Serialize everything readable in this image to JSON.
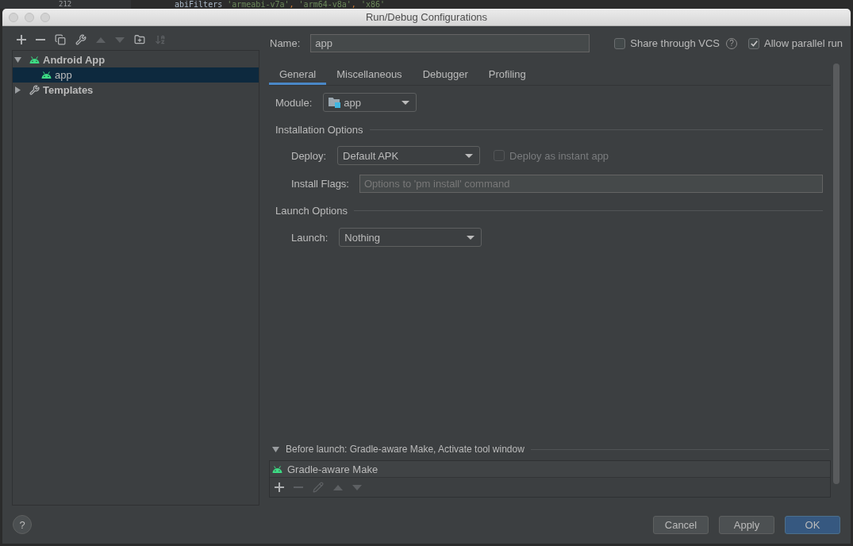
{
  "background_editor": {
    "line_number": "212",
    "tokens": [
      {
        "kind": "identifier",
        "text": "abiFilters"
      },
      {
        "kind": "string",
        "text": "'armeabi-v7a'"
      },
      {
        "kind": "punct",
        "text": ","
      },
      {
        "kind": "string",
        "text": "'arm64-v8a'"
      },
      {
        "kind": "punct",
        "text": ","
      },
      {
        "kind": "string",
        "text": "'x86'"
      }
    ]
  },
  "window": {
    "title": "Run/Debug Configurations"
  },
  "toolbar": [
    {
      "kind": "add",
      "disabled": false
    },
    {
      "kind": "remove",
      "disabled": false
    },
    {
      "kind": "copy",
      "disabled": false
    },
    {
      "kind": "settings",
      "disabled": false
    },
    {
      "kind": "up",
      "disabled": true
    },
    {
      "kind": "down",
      "disabled": true
    },
    {
      "kind": "folder",
      "disabled": false
    },
    {
      "kind": "sort",
      "disabled": true
    }
  ],
  "tree": [
    {
      "label": "Android App",
      "kind": "android",
      "expanded": true,
      "selected": false,
      "children": [
        {
          "label": "app",
          "kind": "android",
          "selected": true
        }
      ]
    },
    {
      "label": "Templates",
      "kind": "wrench",
      "expanded": false,
      "selected": false
    }
  ],
  "name_field": {
    "label": "Name:",
    "value": "app"
  },
  "options": [
    {
      "label": "Share through VCS",
      "checked": false,
      "help": "?"
    },
    {
      "label": "Allow parallel run",
      "checked": true
    }
  ],
  "tabs": [
    {
      "label": "General",
      "selected": true
    },
    {
      "label": "Miscellaneous",
      "selected": false
    },
    {
      "label": "Debugger",
      "selected": false
    },
    {
      "label": "Profiling",
      "selected": false
    }
  ],
  "module": {
    "label": "Module:",
    "value": "app"
  },
  "installation_options": {
    "title": "Installation Options",
    "deploy": {
      "label": "Deploy:",
      "value": "Default APK"
    },
    "instant_app": {
      "label": "Deploy as instant app",
      "checked": false,
      "disabled": true
    },
    "install_flags": {
      "label": "Install Flags:",
      "placeholder": "Options to 'pm install' command"
    }
  },
  "launch_options": {
    "title": "Launch Options",
    "launch": {
      "label": "Launch:",
      "value": "Nothing"
    }
  },
  "before_launch": {
    "title": "Before launch: Gradle-aware Make, Activate tool window",
    "expanded": true,
    "tasks": [
      {
        "label": "Gradle-aware Make",
        "selected": false
      }
    ],
    "toolbar": [
      {
        "kind": "add",
        "disabled": false
      },
      {
        "kind": "remove",
        "disabled": true
      },
      {
        "kind": "edit",
        "disabled": true
      },
      {
        "kind": "up",
        "disabled": true
      },
      {
        "kind": "down",
        "disabled": true
      }
    ]
  },
  "help_button": {
    "label": "?"
  },
  "buttons": [
    {
      "label": "Cancel",
      "default": false
    },
    {
      "label": "Apply",
      "default": false
    },
    {
      "label": "OK",
      "default": true
    }
  ]
}
